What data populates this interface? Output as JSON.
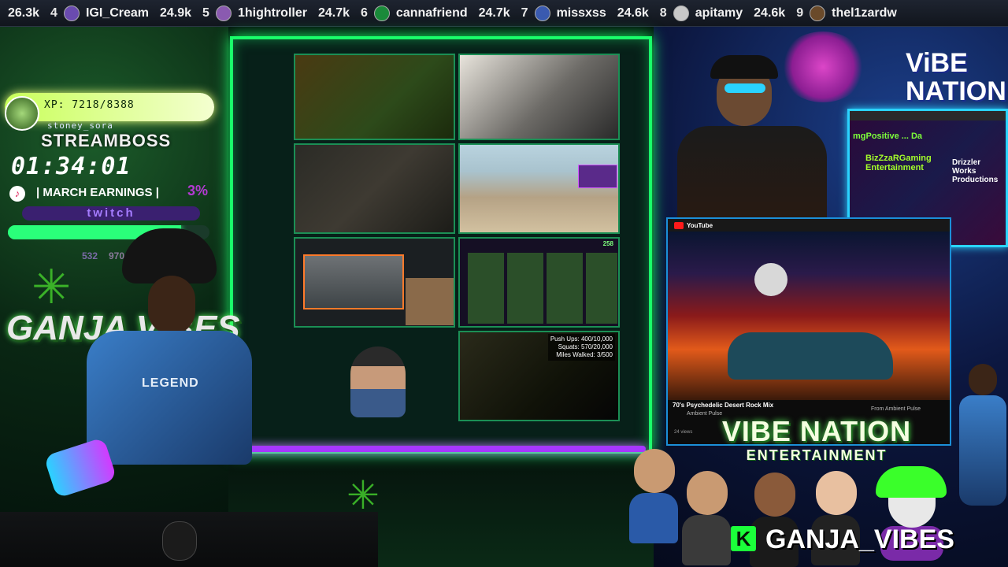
{
  "leaderboard": [
    {
      "rank": "",
      "name": "",
      "score": "26.3k"
    },
    {
      "rank": "4",
      "name": "IGI_Cream",
      "score": "24.9k"
    },
    {
      "rank": "5",
      "name": "1hightroller",
      "score": "24.7k"
    },
    {
      "rank": "6",
      "name": "cannafriend",
      "score": "24.7k"
    },
    {
      "rank": "7",
      "name": "missxss",
      "score": "24.6k"
    },
    {
      "rank": "8",
      "name": "apitamy",
      "score": "24.6k"
    },
    {
      "rank": "9",
      "name": "thel1zardw",
      "score": ""
    }
  ],
  "hud": {
    "xp": "XP: 7218/8388",
    "username": "stoney_sora",
    "role": "STREAMBOSS",
    "timer": "01:34:01",
    "earnings_label": "| MARCH EARNINGS |",
    "earnings_pct": "3%",
    "platform": "twitch",
    "progress_fraction": 0.86,
    "count_a": "532",
    "count_b": "970"
  },
  "left_logo": "GANJA VIBES",
  "streamer_shirt": "LEGEND",
  "tiles": {
    "t8_stats": "Push Ups: 400/10,000\nSquats: 570/20,000\nMiles Walked: 3/500",
    "t6_count": "258"
  },
  "right_art": {
    "vibe_nation_top": "ViBE NATION"
  },
  "popup": {
    "ticker": "mgPositive ... Da",
    "bizz": "BizZzaRGaming Entertainment",
    "drizz": "Drizzler Works Productions"
  },
  "video": {
    "platform": "YouTube",
    "title": "70's Psychedelic Desert Rock Mix",
    "channel": "Ambient Pulse",
    "right_text": "From Ambient Pulse",
    "views": "24 views"
  },
  "vibe_logo": {
    "big": "VIBE NATION",
    "small": "ENTERTAINMENT"
  },
  "kick": {
    "badge": "K",
    "channel": "GANJA_VIBES"
  },
  "colors": {
    "frame": "#19ff6a",
    "frame_bottom": "#a637ff",
    "twitch": "#a57cff",
    "kick": "#1bff3a"
  }
}
